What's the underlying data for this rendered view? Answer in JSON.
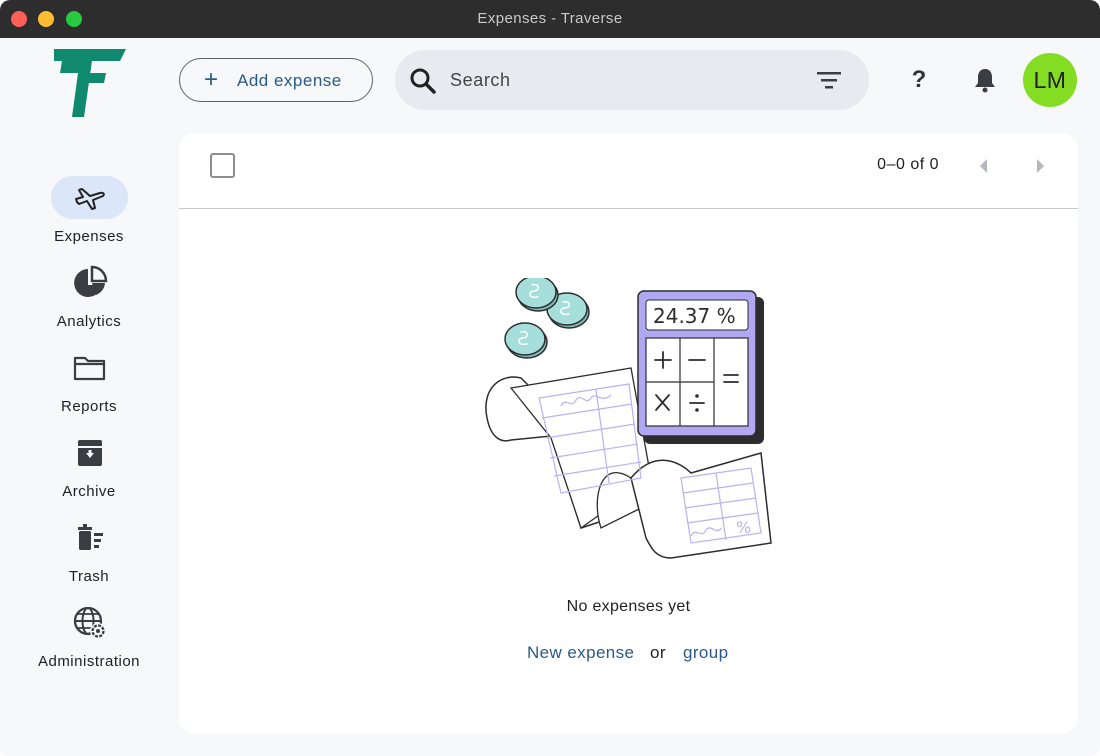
{
  "window": {
    "title": "Expenses - Traverse"
  },
  "sidebar": {
    "items": [
      {
        "label": "Expenses",
        "icon": "airplane-icon",
        "active": true
      },
      {
        "label": "Analytics",
        "icon": "pie-chart-icon",
        "active": false
      },
      {
        "label": "Reports",
        "icon": "folder-icon",
        "active": false
      },
      {
        "label": "Archive",
        "icon": "archive-box-icon",
        "active": false
      },
      {
        "label": "Trash",
        "icon": "trash-icon",
        "active": false
      },
      {
        "label": "Administration",
        "icon": "globe-gear-icon",
        "active": false
      }
    ]
  },
  "toolbar": {
    "add_button_label": "Add expense",
    "add_button_icon": "plus-icon",
    "search_placeholder": "Search",
    "help_label": "?",
    "avatar_initials": "LM"
  },
  "list": {
    "page_count": "0–0 of 0"
  },
  "empty_state": {
    "title": "No expenses yet",
    "new_expense_link": "New expense",
    "or_text": "or",
    "group_link": "group",
    "calculator_display": "24.37 %"
  },
  "colors": {
    "brand": "#0f8a6e",
    "accent_link": "#2a5a8a",
    "active_nav_bg": "#dbe6f8",
    "avatar_bg": "#84dd23",
    "titlebar_bg": "#2d2d2d",
    "calculator_bg": "#b1a7f2",
    "coin_fill": "#a6dedc"
  }
}
